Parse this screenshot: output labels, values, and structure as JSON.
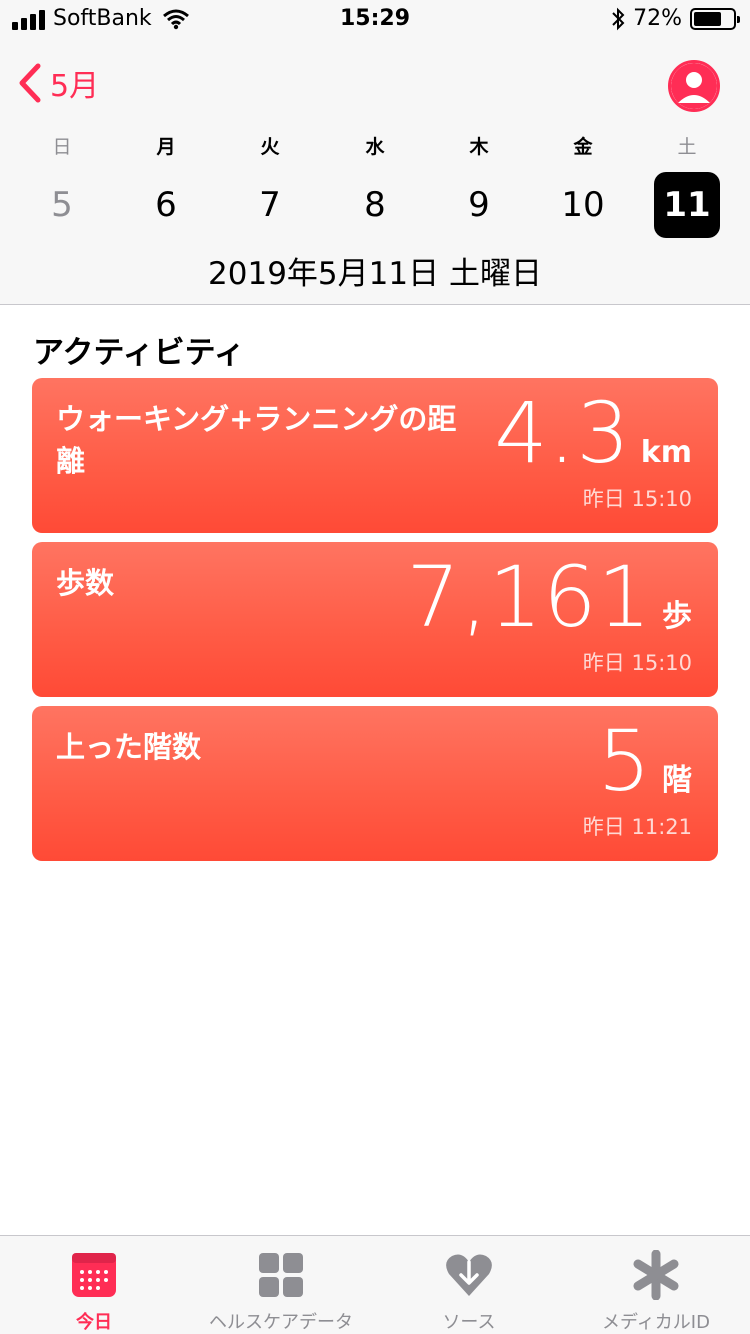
{
  "status_bar": {
    "carrier": "SoftBank",
    "time": "15:29",
    "battery_percent": "72%",
    "battery_level": 0.72
  },
  "header": {
    "back_label": "5月",
    "weekdays": [
      "日",
      "月",
      "火",
      "水",
      "木",
      "金",
      "土"
    ],
    "days": [
      "5",
      "6",
      "7",
      "8",
      "9",
      "10",
      "11"
    ],
    "selected_day": "11",
    "full_date": "2019年5月11日 土曜日"
  },
  "activity": {
    "section_title": "アクティビティ",
    "cards": [
      {
        "title": "ウォーキング+ランニングの距離",
        "value": "4.3",
        "unit": "km",
        "time": "昨日 15:10"
      },
      {
        "title": "歩数",
        "value": "7,161",
        "unit": "歩",
        "time": "昨日 15:10"
      },
      {
        "title": "上った階数",
        "value": "5",
        "unit": "階",
        "time": "昨日 11:21"
      }
    ]
  },
  "tab_bar": {
    "tabs": [
      {
        "label": "今日",
        "icon": "calendar-icon",
        "active": true
      },
      {
        "label": "ヘルスケアデータ",
        "icon": "grid-icon",
        "active": false
      },
      {
        "label": "ソース",
        "icon": "heart-download-icon",
        "active": false
      },
      {
        "label": "メディカルID",
        "icon": "asterisk-icon",
        "active": false
      }
    ]
  },
  "colors": {
    "accent": "#ff2d55",
    "card_top": "#ff7461",
    "card_bottom": "#ff4a36",
    "muted": "#8e8e93"
  }
}
